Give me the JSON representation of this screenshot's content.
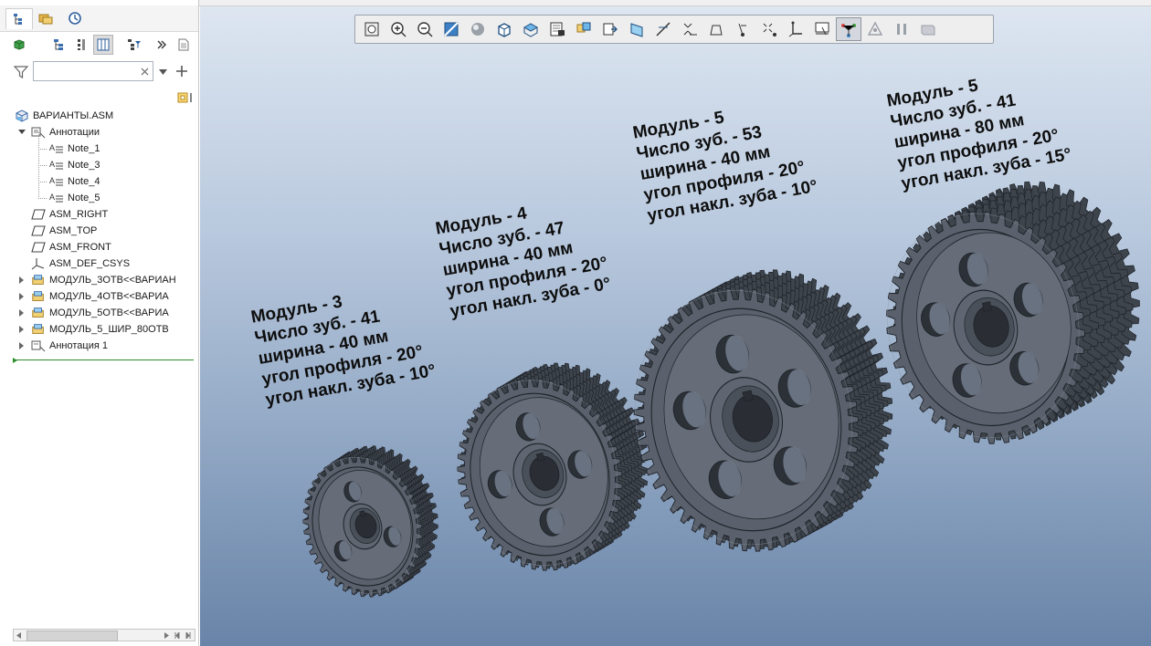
{
  "sidebar": {
    "search": {
      "value": "",
      "placeholder": ""
    },
    "tree": [
      {
        "label": "ВАРИАНТЫ.ASM",
        "icon": "assembly-icon"
      },
      {
        "label": "Аннотации",
        "icon": "annotations-icon"
      },
      {
        "label": "Note_1",
        "icon": "note-icon"
      },
      {
        "label": "Note_3",
        "icon": "note-icon"
      },
      {
        "label": "Note_4",
        "icon": "note-icon"
      },
      {
        "label": "Note_5",
        "icon": "note-icon"
      },
      {
        "label": "ASM_RIGHT",
        "icon": "datum-plane-icon"
      },
      {
        "label": "ASM_TOP",
        "icon": "datum-plane-icon"
      },
      {
        "label": "ASM_FRONT",
        "icon": "datum-plane-icon"
      },
      {
        "label": "ASM_DEF_CSYS",
        "icon": "csys-icon"
      },
      {
        "label": "МОДУЛЬ_3ОТВ<<ВАРИАН",
        "icon": "subassembly-icon"
      },
      {
        "label": "МОДУЛЬ_4ОТВ<<ВАРИА",
        "icon": "subassembly-icon"
      },
      {
        "label": "МОДУЛЬ_5ОТВ<<ВАРИА",
        "icon": "subassembly-icon"
      },
      {
        "label": "МОДУЛЬ_5_ШИР_80ОТВ",
        "icon": "subassembly-icon"
      },
      {
        "label": "Аннотация 1",
        "icon": "annotation-feature-icon"
      }
    ]
  },
  "notes": [
    {
      "line1": "Модуль - 3",
      "line2": "Число зуб. - 41",
      "line3": "ширина - 40 мм",
      "line4": "угол профиля - 20°",
      "line5": "угол накл. зуба - 10°"
    },
    {
      "line1": "Модуль - 4",
      "line2": "Число зуб. - 47",
      "line3": "ширина - 40 мм",
      "line4": "угол профиля - 20°",
      "line5": "угол накл. зуба - 0°"
    },
    {
      "line1": "Модуль - 5",
      "line2": "Число зуб. - 53",
      "line3": "ширина - 40 мм",
      "line4": "угол профиля - 20°",
      "line5": "угол накл. зуба - 10°"
    },
    {
      "line1": "Модуль - 5",
      "line2": "Число зуб. - 41",
      "line3": "ширина - 80 мм",
      "line4": "угол профиля - 20°",
      "line5": "угол накл. зуба - 15°"
    }
  ],
  "gears": [
    {
      "teeth": 41,
      "holes": 3
    },
    {
      "teeth": 47,
      "holes": 4
    },
    {
      "teeth": 53,
      "holes": 5
    },
    {
      "teeth": 41,
      "holes": 5
    }
  ],
  "colors": {
    "gear_fill": "#5a616c",
    "gear_dark": "#3e444c",
    "gear_edge": "#1f2329",
    "selected": "#2c8c2c"
  },
  "view_toolbar": [
    "refit-icon",
    "zoom-in-icon",
    "zoom-out-icon",
    "repaint-icon",
    "display-style-icon",
    "saved-orientations-icon",
    "view-manager-icon",
    "perspective-icon",
    "section-icon",
    "annotation-display-icon",
    "datum-display-icon",
    "plane-display-icon",
    "axis-display-icon",
    "point-display-icon",
    "csys-display-icon",
    "spin-center-icon",
    "annotation-filter-icon",
    "sketch-icon",
    "simplify-icon",
    "pause-icon",
    "next-icon"
  ]
}
